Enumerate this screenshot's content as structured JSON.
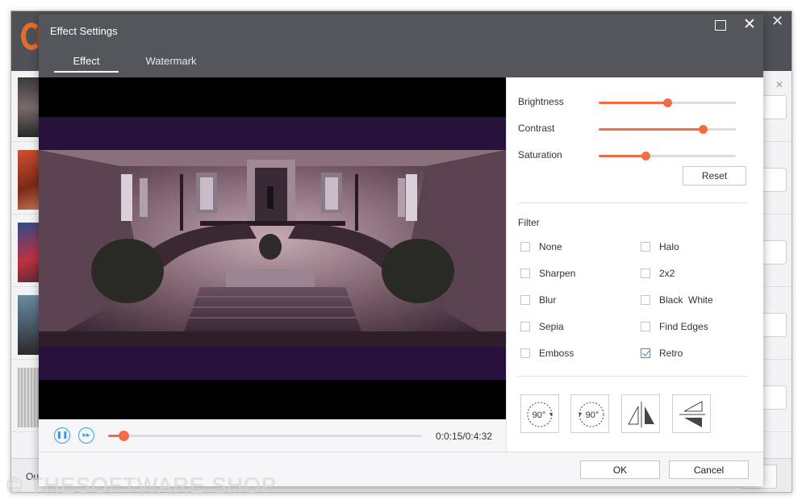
{
  "dialog": {
    "title": "Effect Settings",
    "tabs": [
      {
        "label": "Effect",
        "active": true
      },
      {
        "label": "Watermark",
        "active": false
      }
    ]
  },
  "player": {
    "time": "0:0:15/0:4:32",
    "progress_fraction": 0.05
  },
  "adjustments": [
    {
      "label": "Brightness",
      "value_fraction": 0.5
    },
    {
      "label": "Contrast",
      "value_fraction": 0.76
    },
    {
      "label": "Saturation",
      "value_fraction": 0.34
    }
  ],
  "reset_label": "Reset",
  "filter": {
    "title": "Filter",
    "options": [
      {
        "label": "None",
        "checked": false
      },
      {
        "label": "Halo",
        "checked": false
      },
      {
        "label": "Sharpen",
        "checked": false
      },
      {
        "label": "2x2",
        "checked": false
      },
      {
        "label": "Blur",
        "checked": false
      },
      {
        "label": "Black  White",
        "checked": false
      },
      {
        "label": "Sepia",
        "checked": false
      },
      {
        "label": "Find Edges",
        "checked": false
      },
      {
        "label": "Emboss",
        "checked": false
      },
      {
        "label": "Retro",
        "checked": true
      }
    ]
  },
  "rotate_buttons": {
    "clockwise_label": "90°",
    "counterclockwise_label": "90°"
  },
  "footer": {
    "ok_label": "OK",
    "cancel_label": "Cancel"
  },
  "background_app": {
    "output_label": "Ou"
  },
  "watermark_text": "© THESOFTWARE.SHOP",
  "colors": {
    "accent": "#f26b47",
    "header": "#54565b",
    "play_controls": "#2f9de6"
  }
}
